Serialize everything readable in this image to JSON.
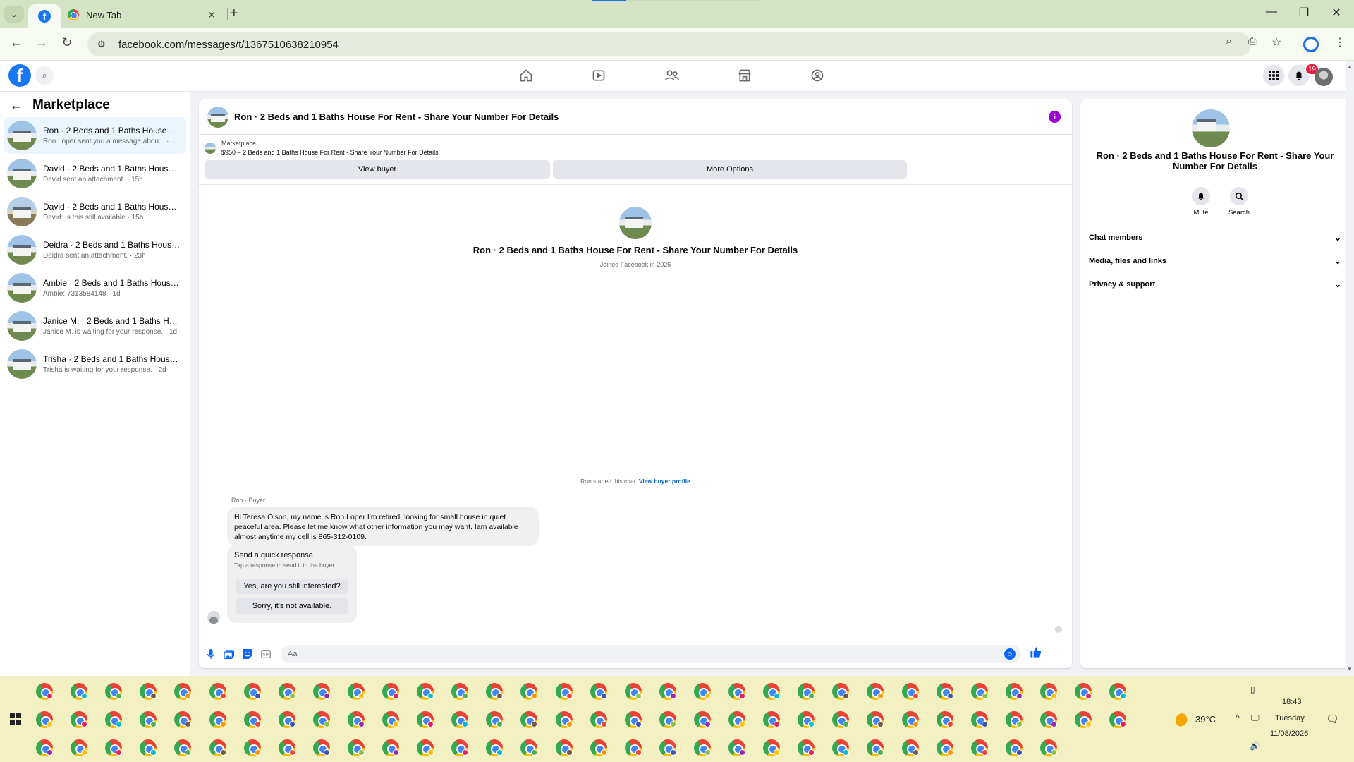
{
  "browser": {
    "tabs": [
      {
        "title": "",
        "icon": "facebook-icon",
        "active": true
      },
      {
        "title": "New Tab",
        "icon": "chrome-icon",
        "active": false
      }
    ],
    "url": "facebook.com/messages/t/1367510638210954"
  },
  "fb": {
    "notifications_count": "19"
  },
  "sidebar": {
    "title": "Marketplace",
    "conversations": [
      {
        "name": "Ron · 2 Beds and 1 Baths House Fo...",
        "preview": "Ron Loper sent you a message abou... · 47m",
        "active": true
      },
      {
        "name": "David · 2 Beds and 1 Baths House ...",
        "preview": "David sent an attachment. · 15h",
        "active": false
      },
      {
        "name": "David · 2 Beds and 1 Baths House ...",
        "preview": "David: Is this still available · 15h",
        "active": false
      },
      {
        "name": "Deidra · 2 Beds and 1 Baths House ...",
        "preview": "Deidra sent an attachment. · 23h",
        "active": false
      },
      {
        "name": "Ambie · 2 Beds and 1 Baths House ...",
        "preview": "Ambie: 7313584148 · 1d",
        "active": false
      },
      {
        "name": "Janice M. · 2 Beds and 1 Baths Hou...",
        "preview": "Janice M. is waiting for your response. · 1d",
        "active": false
      },
      {
        "name": "Trisha · 2 Beds and 1 Baths House ...",
        "preview": "Trisha is waiting for your response. · 2d",
        "active": false
      }
    ]
  },
  "chat": {
    "title": "Ron · 2 Beds and 1 Baths House For Rent - Share Your Number For Details",
    "marketplace_label": "Marketplace",
    "listing": "$950 – 2 Beds and 1 Baths House For Rent - Share Your Number For Details",
    "view_buyer": "View buyer",
    "more_options": "More Options",
    "profile_name": "Ron · 2 Beds and 1 Baths House For Rent - Share Your Number For Details",
    "joined": "Joined Facebook in 2026",
    "started_text": "Ron started this chat.",
    "view_profile_link": "View buyer profile",
    "sender_label": "Ron · Buyer",
    "message": "Hi Teresa Olson, my name is Ron Loper I'm retired, looking for small house in quiet peaceful area. Please let me know what other information you may want. Iam available almost anytime  my cell is 865-312-0109.",
    "quick_title": "Send a quick response",
    "quick_sub": "Tap a response to send it to the buyer.",
    "quick_options": [
      "Yes, are you still interested?",
      "Sorry, it's not available."
    ],
    "composer_placeholder": "Aa"
  },
  "right_panel": {
    "name": "Ron · 2 Beds and 1 Baths House For Rent - Share Your Number For Details",
    "mute_label": "Mute",
    "search_label": "Search",
    "sections": [
      "Chat members",
      "Media, files and links",
      "Privacy & support"
    ]
  },
  "taskbar": {
    "temperature": "39°C",
    "time": "18:43",
    "day": "Tuesday",
    "date": "11/08/2026"
  },
  "colors": {
    "fb_blue": "#1877f2",
    "messenger_blue": "#0866ff",
    "info_purple": "#a200d8",
    "tab_bar": "#d3e3c3",
    "taskbar": "#f3f0c2"
  }
}
